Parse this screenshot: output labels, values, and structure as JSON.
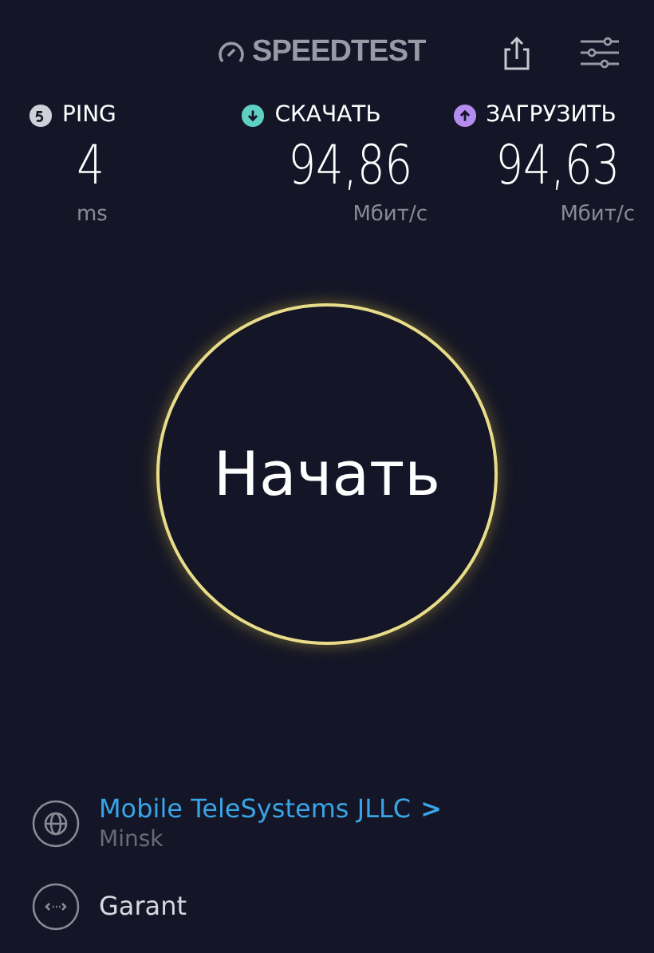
{
  "header": {
    "logo": "SPEEDTEST"
  },
  "metrics": [
    {
      "kind": "ping",
      "label": "PING",
      "value": "4",
      "unit": "ms",
      "color": "#d0d0d8"
    },
    {
      "kind": "download",
      "label": "СКАЧАТЬ",
      "value": "94,86",
      "unit": "Мбит/с",
      "color": "#5fd1c3"
    },
    {
      "kind": "upload",
      "label": "ЗАГРУЗИТЬ",
      "value": "94,63",
      "unit": "Мбит/с",
      "color": "#b48cf0"
    }
  ],
  "start_button": {
    "label": "Начать"
  },
  "provider": {
    "name": "Mobile TeleSystems JLLC",
    "chevron": ">",
    "location": "Minsk"
  },
  "server": {
    "name": "Garant"
  }
}
